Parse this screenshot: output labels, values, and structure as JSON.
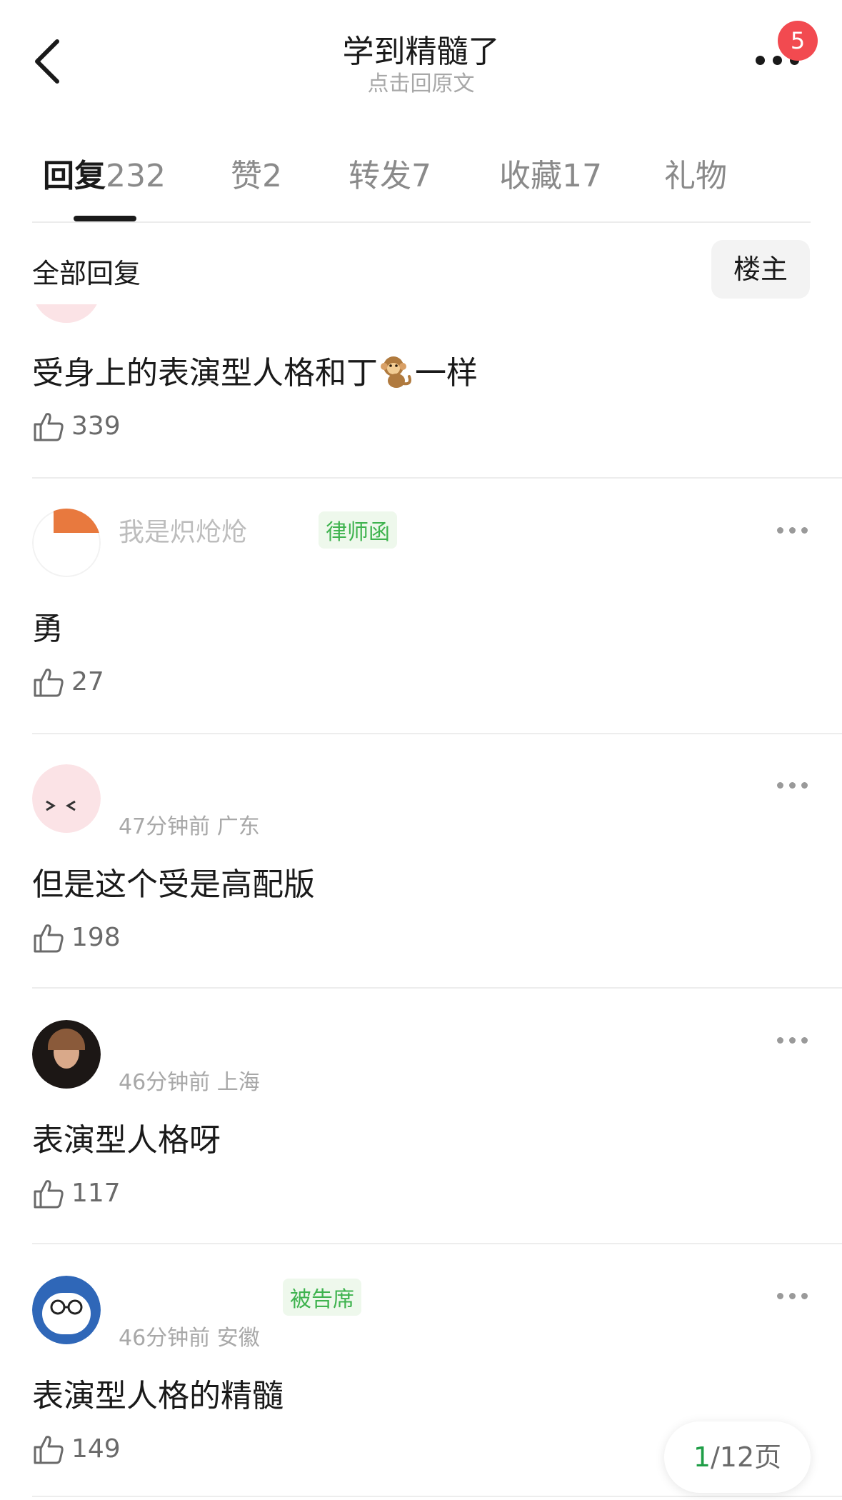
{
  "header": {
    "title": "学到精髓了",
    "subtitle": "点击回原文",
    "notification_count": "5"
  },
  "tabs": [
    {
      "label": "回复",
      "count": "232"
    },
    {
      "label": "赞",
      "count": "2"
    },
    {
      "label": "转发",
      "count": "7"
    },
    {
      "label": "收藏",
      "count": "17"
    },
    {
      "label": "礼物",
      "count": ""
    }
  ],
  "filter": {
    "label": "全部回复",
    "owner_button": "楼主"
  },
  "comments": [
    {
      "time": "",
      "location": "",
      "username": "",
      "tag": "",
      "text_before": "受身上的表演型人格和丁",
      "text_after": "一样",
      "emoji": "monkey-emoji",
      "likes": "339"
    },
    {
      "time": "",
      "location": "",
      "username": "我是炽炝炝",
      "tag": "律师函",
      "text": "勇",
      "likes": "27"
    },
    {
      "time": "47分钟前",
      "location": "广东",
      "text": "但是这个受是高配版",
      "likes": "198"
    },
    {
      "time": "46分钟前",
      "location": "上海",
      "text": "表演型人格呀",
      "likes": "117"
    },
    {
      "time": "46分钟前",
      "location": "安徽",
      "tag": "被告席",
      "text": "表演型人格的精髓",
      "likes": "149"
    }
  ],
  "pager": {
    "current": "1",
    "total_text": "/12页"
  },
  "colors": {
    "accent_green": "#3fb34f",
    "badge_red": "#f24a50",
    "pager_green": "#1f9e47"
  }
}
